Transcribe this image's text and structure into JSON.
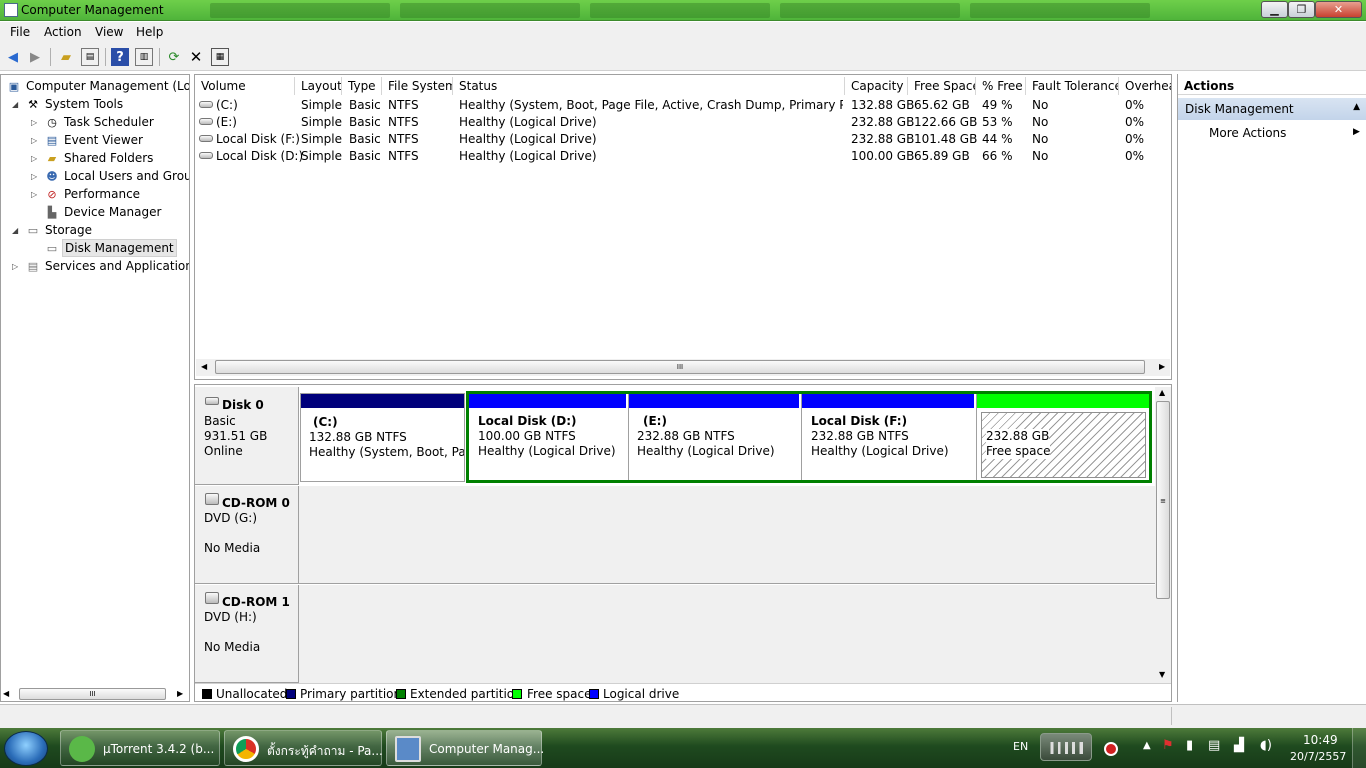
{
  "window": {
    "title": "Computer Management"
  },
  "menu": [
    "File",
    "Action",
    "View",
    "Help"
  ],
  "tree": {
    "root": "Computer Management (Local",
    "system_tools": "System Tools",
    "task_scheduler": "Task Scheduler",
    "event_viewer": "Event Viewer",
    "shared_folders": "Shared Folders",
    "local_users": "Local Users and Groups",
    "performance": "Performance",
    "device_manager": "Device Manager",
    "storage": "Storage",
    "disk_management": "Disk Management",
    "services": "Services and Applications"
  },
  "volumes": {
    "columns": [
      "Volume",
      "Layout",
      "Type",
      "File System",
      "Status",
      "Capacity",
      "Free Space",
      "% Free",
      "Fault Tolerance",
      "Overhea"
    ],
    "rows": [
      {
        "volume": "(C:)",
        "layout": "Simple",
        "type": "Basic",
        "fs": "NTFS",
        "status": "Healthy (System, Boot, Page File, Active, Crash Dump, Primary Partition)",
        "capacity": "132.88 GB",
        "free": "65.62 GB",
        "pct": "49 %",
        "fault": "No",
        "overhead": "0%"
      },
      {
        "volume": "(E:)",
        "layout": "Simple",
        "type": "Basic",
        "fs": "NTFS",
        "status": "Healthy (Logical Drive)",
        "capacity": "232.88 GB",
        "free": "122.66 GB",
        "pct": "53 %",
        "fault": "No",
        "overhead": "0%"
      },
      {
        "volume": "Local Disk  (F:)",
        "layout": "Simple",
        "type": "Basic",
        "fs": "NTFS",
        "status": "Healthy (Logical Drive)",
        "capacity": "232.88 GB",
        "free": "101.48 GB",
        "pct": "44 %",
        "fault": "No",
        "overhead": "0%"
      },
      {
        "volume": "Local Disk (D:)",
        "layout": "Simple",
        "type": "Basic",
        "fs": "NTFS",
        "status": "Healthy (Logical Drive)",
        "capacity": "100.00 GB",
        "free": "65.89 GB",
        "pct": "66 %",
        "fault": "No",
        "overhead": "0%"
      }
    ]
  },
  "disks": [
    {
      "name": "Disk 0",
      "type": "Basic",
      "size": "931.51 GB",
      "state": "Online"
    },
    {
      "name": "CD-ROM 0",
      "type": "DVD (G:)",
      "size": "",
      "state": "No Media"
    },
    {
      "name": "CD-ROM 1",
      "type": "DVD (H:)",
      "size": "",
      "state": "No Media"
    }
  ],
  "partitions": [
    {
      "name": "(C:)",
      "size": "132.88 GB NTFS",
      "status": "Healthy (System, Boot, Page",
      "bar_color": "#00007b"
    },
    {
      "name": "Local Disk  (D:)",
      "size": "100.00 GB NTFS",
      "status": "Healthy (Logical Drive)",
      "bar_color": "#0000ff"
    },
    {
      "name": "(E:)",
      "size": "232.88 GB NTFS",
      "status": "Healthy (Logical Drive)",
      "bar_color": "#0000ff"
    },
    {
      "name": "Local Disk   (F:)",
      "size": "232.88 GB NTFS",
      "status": "Healthy (Logical Drive)",
      "bar_color": "#0000ff"
    },
    {
      "name": "",
      "size": "232.88 GB",
      "status": "Free space",
      "bar_color": "#00ff00"
    }
  ],
  "legend": [
    {
      "label": "Unallocated",
      "color": "#000000"
    },
    {
      "label": "Primary partition",
      "color": "#00007b"
    },
    {
      "label": "Extended partition",
      "color": "#008000"
    },
    {
      "label": "Free space",
      "color": "#00ff00"
    },
    {
      "label": "Logical drive",
      "color": "#0000ff"
    }
  ],
  "actions": {
    "header": "Actions",
    "section": "Disk Management",
    "more": "More Actions"
  },
  "taskbar": {
    "items": [
      "µTorrent 3.4.2  (b...",
      "ตั้งกระทู้คำถาม - Pa...",
      "Computer Manag..."
    ],
    "lang": "EN",
    "time": "10:49",
    "date": "20/7/2557"
  }
}
